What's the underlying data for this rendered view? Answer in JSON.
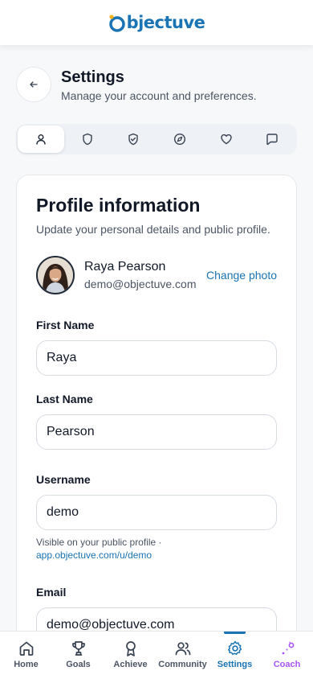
{
  "app": {
    "logo_text": "bjectuve"
  },
  "header": {
    "title": "Settings",
    "subtitle": "Manage your account and preferences."
  },
  "tabs": [
    {
      "icon": "user-icon",
      "active": true
    },
    {
      "icon": "shield-icon",
      "active": false
    },
    {
      "icon": "shield-check-icon",
      "active": false
    },
    {
      "icon": "compass-icon",
      "active": false
    },
    {
      "icon": "heart-icon",
      "active": false
    },
    {
      "icon": "message-icon",
      "active": false
    }
  ],
  "profile": {
    "title": "Profile information",
    "subtitle": "Update your personal details and public profile.",
    "name": "Raya Pearson",
    "email": "demo@objectuve.com",
    "change_photo": "Change photo"
  },
  "form": {
    "first_name_label": "First Name",
    "first_name_value": "Raya",
    "last_name_label": "Last Name",
    "last_name_value": "Pearson",
    "username_label": "Username",
    "username_value": "demo",
    "username_hint": "Visible on your public profile ·",
    "username_link": "app.objectuve.com/u/demo",
    "email_label": "Email",
    "email_value": "demo@objectuve.com"
  },
  "nav": [
    {
      "label": "Home",
      "icon": "home-icon"
    },
    {
      "label": "Goals",
      "icon": "trophy-icon"
    },
    {
      "label": "Achieve",
      "icon": "award-icon"
    },
    {
      "label": "Community",
      "icon": "users-icon"
    },
    {
      "label": "Settings",
      "icon": "gear-icon",
      "active": true
    },
    {
      "label": "Coach",
      "icon": "sparkle-icon"
    }
  ],
  "colors": {
    "accent": "#1a73b3",
    "coach": "#a855f7",
    "logo_dot": "#f5b323"
  }
}
